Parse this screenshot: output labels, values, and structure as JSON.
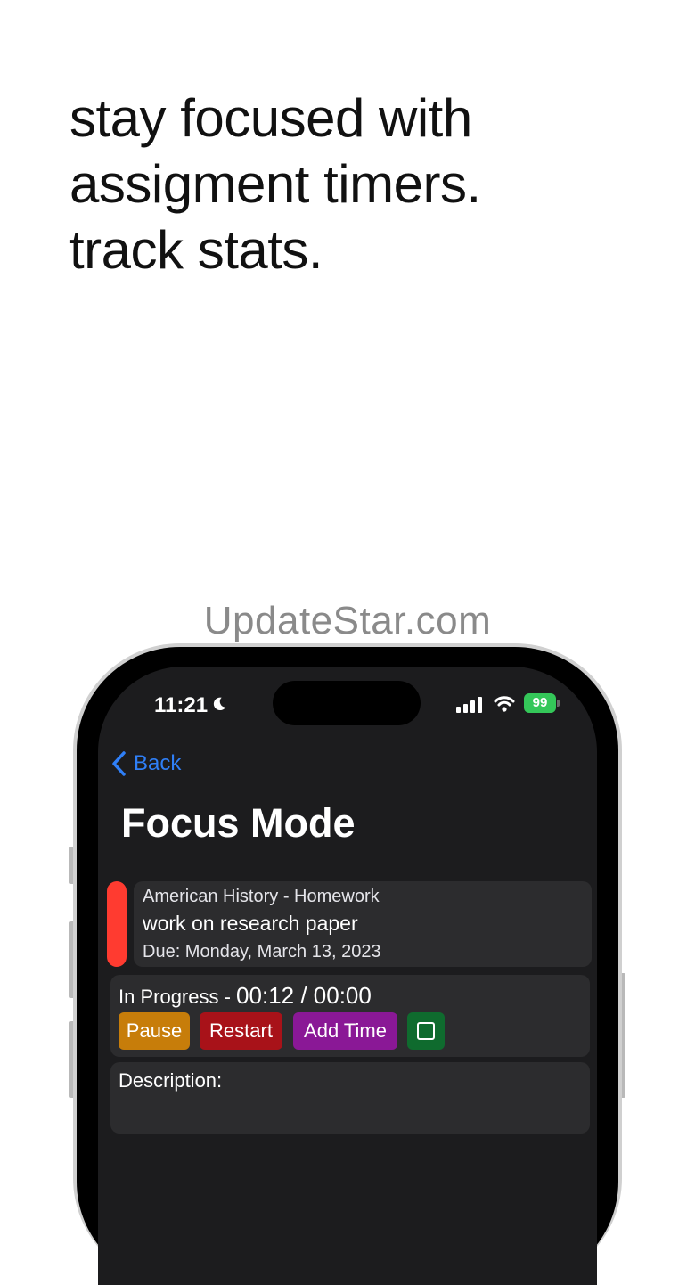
{
  "headline": [
    "stay focused with",
    "assigment timers.",
    "track stats."
  ],
  "watermark": "UpdateStar.com",
  "status_bar": {
    "time": "11:21",
    "battery": "99",
    "battery_color": "#34c759",
    "icons": [
      "moon-icon",
      "signal-icon",
      "wifi-icon",
      "battery-icon"
    ]
  },
  "nav": {
    "back_label": "Back"
  },
  "page_title": "Focus Mode",
  "assignment": {
    "course": "American History - Homework",
    "task": "work on research paper",
    "due": "Due: Monday, March 13, 2023",
    "color": "#ff3b30"
  },
  "progress": {
    "status": "In Progress - ",
    "elapsed": "00:12 / 00:00",
    "buttons": {
      "pause": "Pause",
      "restart": "Restart",
      "add_time": "Add Time"
    }
  },
  "description": {
    "label": "Description:"
  }
}
